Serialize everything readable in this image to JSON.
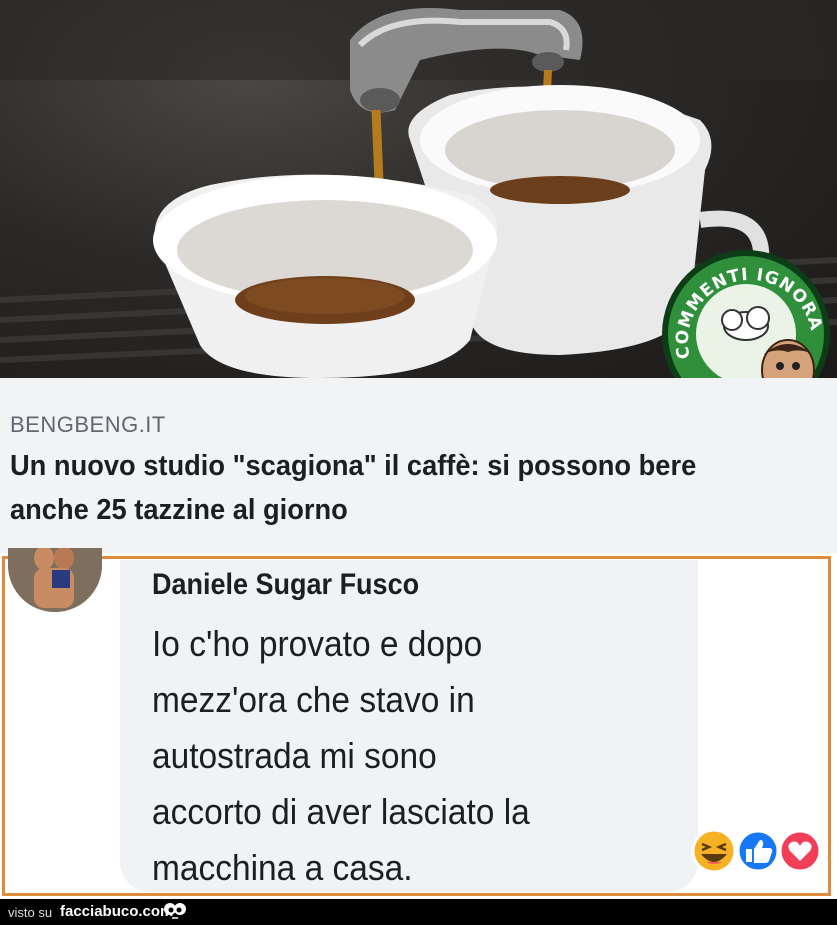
{
  "link_preview": {
    "source": "BENGBENG.IT",
    "title": "Un nuovo studio \"scagiona\" il caffè: si possono bere anche 25 tazzine al giorno"
  },
  "stamp": {
    "text": "COMMENTI IGNORANTI",
    "colors": {
      "ring": "#2f8f3a",
      "border": "#0d3d17",
      "text": "#ffffff"
    }
  },
  "comment": {
    "author": "Daniele Sugar Fusco",
    "text_lines": [
      "Io c'ho provato e dopo",
      "mezz'ora che stavo in",
      "autostrada mi sono",
      "accorto di aver lasciato la",
      "macchina a casa."
    ],
    "reactions": [
      "haha-icon",
      "like-icon",
      "love-icon"
    ]
  },
  "footer": {
    "prefix": "visto su",
    "site": "facciabuco.com"
  },
  "colors": {
    "frame_border": "#e08c3d",
    "bubble_bg": "#f0f2f5",
    "preview_bg": "#f2f3f5",
    "like": "#1877f2",
    "love": "#f33e58",
    "haha": "#f7b125"
  }
}
